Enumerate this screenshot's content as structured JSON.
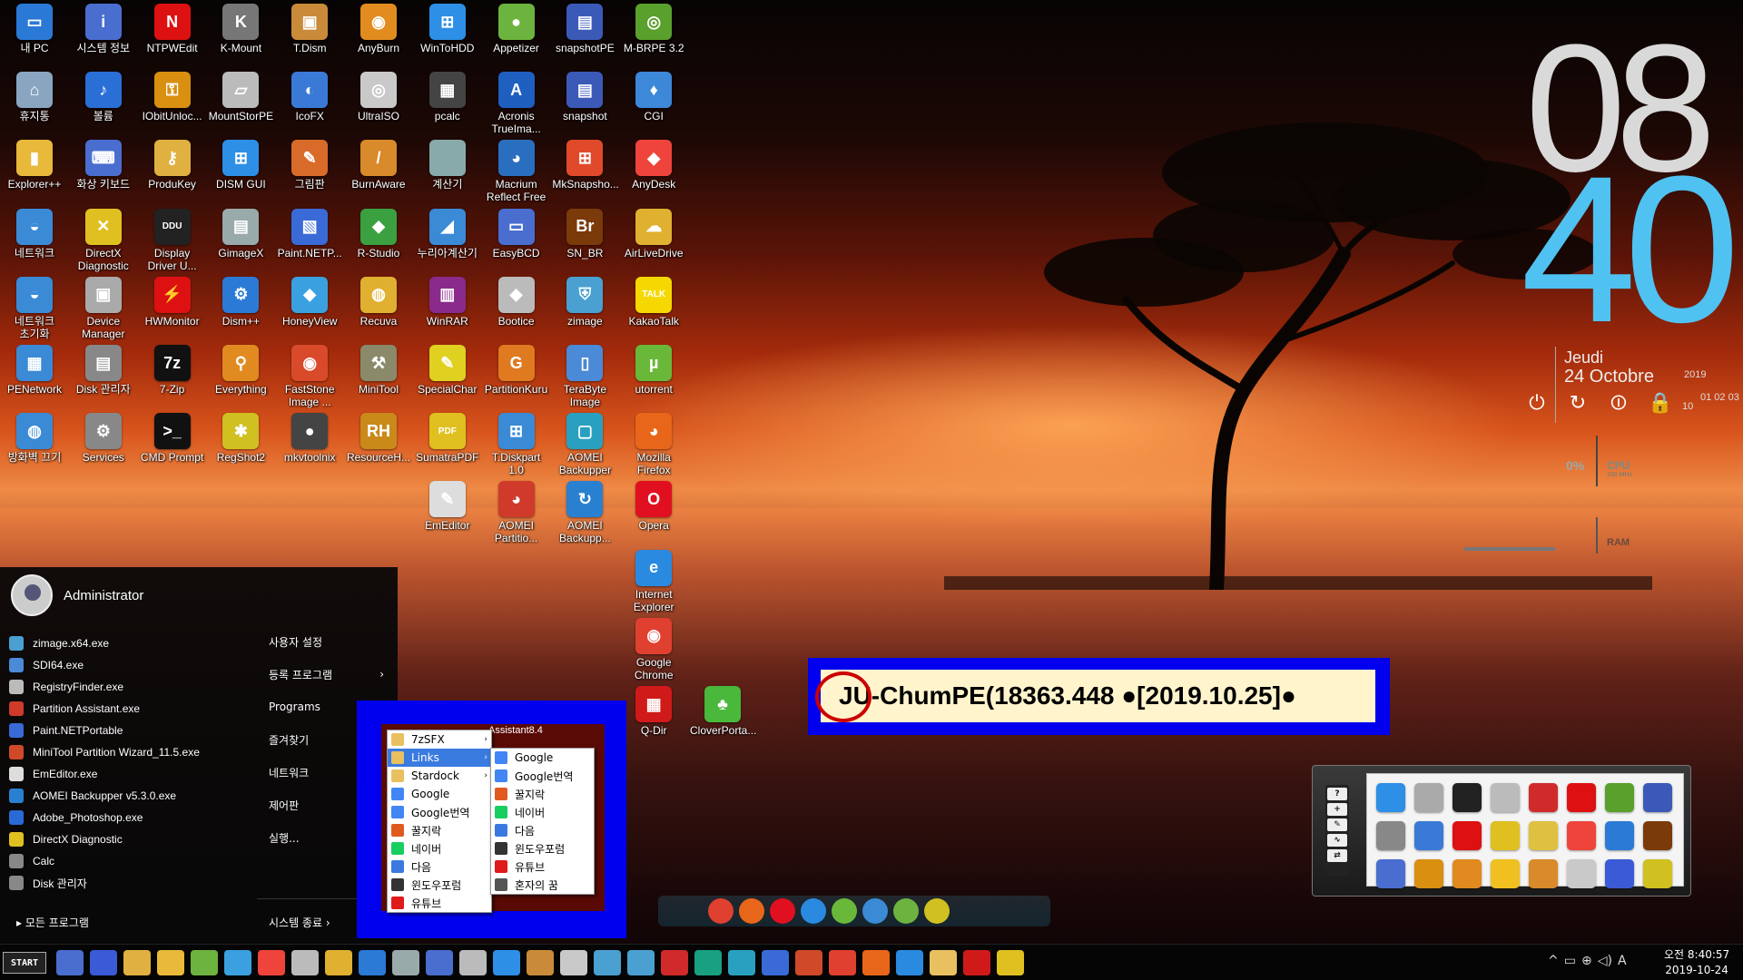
{
  "desktop_icons": [
    {
      "label": "내 PC",
      "color": "#2a79d6",
      "glyph": "▭"
    },
    {
      "label": "시스템 정보",
      "color": "#4a6ecf",
      "glyph": "i"
    },
    {
      "label": "NTPWEdit",
      "color": "#d11",
      "glyph": "N"
    },
    {
      "label": "K-Mount",
      "color": "#777",
      "glyph": "K"
    },
    {
      "label": "T.Dism",
      "color": "#c98b3a",
      "glyph": "▣"
    },
    {
      "label": "AnyBurn",
      "color": "#e28c20",
      "glyph": "◉"
    },
    {
      "label": "WinToHDD",
      "color": "#2d8fe6",
      "glyph": "⊞"
    },
    {
      "label": "Appetizer",
      "color": "#6db33f",
      "glyph": "●"
    },
    {
      "label": "snapshotPE",
      "color": "#3b5ab8",
      "glyph": "▤"
    },
    {
      "label": "M-BRPE 3.2",
      "color": "#5aa02c",
      "glyph": "◎"
    },
    {
      "label": "휴지통",
      "color": "#8aa5c0",
      "glyph": "⌂"
    },
    {
      "label": "볼륨",
      "color": "#2a6fd6",
      "glyph": "♪"
    },
    {
      "label": "IObitUnloc...",
      "color": "#d98f10",
      "glyph": "⚿"
    },
    {
      "label": "MountStorPE",
      "color": "#bbb",
      "glyph": "▱"
    },
    {
      "label": "IcoFX",
      "color": "#3a7ad6",
      "glyph": "◐"
    },
    {
      "label": "UltraISO",
      "color": "#c9c9c9",
      "glyph": "◎"
    },
    {
      "label": "pcalc",
      "color": "#444",
      "glyph": "▦"
    },
    {
      "label": "Acronis\nTrueIma...",
      "color": "#1f5fbf",
      "glyph": "A"
    },
    {
      "label": "snapshot",
      "color": "#3b5ab8",
      "glyph": "▤"
    },
    {
      "label": "CGI",
      "color": "#3d88d9",
      "glyph": "♦"
    },
    {
      "label": "Explorer++",
      "color": "#e8b93a",
      "glyph": "▮"
    },
    {
      "label": "화상 키보드",
      "color": "#4a6ecf",
      "glyph": "⌨"
    },
    {
      "label": "ProduKey",
      "color": "#e0b040",
      "glyph": "⚷"
    },
    {
      "label": "DISM GUI",
      "color": "#2d8fe6",
      "glyph": "⊞"
    },
    {
      "label": "그림판",
      "color": "#d96b2a",
      "glyph": "✎"
    },
    {
      "label": "BurnAware",
      "color": "#d98a2a",
      "glyph": "/"
    },
    {
      "label": "계산기",
      "color": "#8aa"
    },
    {
      "label": "Macrium\nReflect Free",
      "color": "#2a6fbf",
      "glyph": "◕"
    },
    {
      "label": "MkSnapsho...",
      "color": "#e04a2a",
      "glyph": "⊞"
    },
    {
      "label": "AnyDesk",
      "color": "#ef443b",
      "glyph": "◆"
    },
    {
      "label": "네트워크",
      "color": "#3a8ad6",
      "glyph": "◒"
    },
    {
      "label": "DirectX\nDiagnostic",
      "color": "#e0c020",
      "glyph": "✕"
    },
    {
      "label": "Display\nDriver U...",
      "color": "#222",
      "glyph": "DDU"
    },
    {
      "label": "GimageX",
      "color": "#9aa",
      "glyph": "▤"
    },
    {
      "label": "Paint.NETP...",
      "color": "#3a6ad6",
      "glyph": "▧"
    },
    {
      "label": "R-Studio",
      "color": "#3aa040",
      "glyph": "◆"
    },
    {
      "label": "누리아계산기",
      "color": "#3a8ad6",
      "glyph": "◢"
    },
    {
      "label": "EasyBCD",
      "color": "#4a6ecf",
      "glyph": "▭"
    },
    {
      "label": "SN_BR",
      "color": "#7a3a0a",
      "glyph": "Br"
    },
    {
      "label": "AirLiveDrive",
      "color": "#e0b030",
      "glyph": "☁"
    },
    {
      "label": "네트워크\n초기화",
      "color": "#3a8ad6",
      "glyph": "◒"
    },
    {
      "label": "Device\nManager",
      "color": "#aaa",
      "glyph": "▣"
    },
    {
      "label": "HWMonitor",
      "color": "#d11",
      "glyph": "⚡"
    },
    {
      "label": "Dism++",
      "color": "#2a7ad6",
      "glyph": "⚙"
    },
    {
      "label": "HoneyView",
      "color": "#3aa0e0",
      "glyph": "◆"
    },
    {
      "label": "Recuva",
      "color": "#e0b030",
      "glyph": "◍"
    },
    {
      "label": "WinRAR",
      "color": "#8a2a8a",
      "glyph": "▥"
    },
    {
      "label": "Bootice",
      "color": "#bbb",
      "glyph": "◆"
    },
    {
      "label": "zimage",
      "color": "#4aa0d0",
      "glyph": "⛨"
    },
    {
      "label": "KakaoTalk",
      "color": "#f5d800",
      "glyph": "TALK"
    },
    {
      "label": "PENetwork",
      "color": "#3a8ad6",
      "glyph": "▦"
    },
    {
      "label": "Disk 관리자",
      "color": "#888",
      "glyph": "▤"
    },
    {
      "label": "7-Zip",
      "color": "#111",
      "glyph": "7z"
    },
    {
      "label": "Everything",
      "color": "#e08a20",
      "glyph": "⚲"
    },
    {
      "label": "FastStone\nImage ...",
      "color": "#d94a2a",
      "glyph": "◉"
    },
    {
      "label": "MiniTool",
      "color": "#8a8a6a",
      "glyph": "⚒"
    },
    {
      "label": "SpecialChar",
      "color": "#e0d020",
      "glyph": "✎"
    },
    {
      "label": "PartitionKuru",
      "color": "#e07a20",
      "glyph": "G"
    },
    {
      "label": "TeraByte\nImage",
      "color": "#4a8ad6",
      "glyph": "▯"
    },
    {
      "label": "utorrent",
      "color": "#6ab83a",
      "glyph": "µ"
    },
    {
      "label": "방화벽 끄기",
      "color": "#3a8ad6",
      "glyph": "◍"
    },
    {
      "label": "Services",
      "color": "#888",
      "glyph": "⚙"
    },
    {
      "label": "CMD Prompt",
      "color": "#111",
      "glyph": ">_"
    },
    {
      "label": "RegShot2",
      "color": "#d0c020",
      "glyph": "✱"
    },
    {
      "label": "mkvtoolnix",
      "color": "#444",
      "glyph": "●"
    },
    {
      "label": "ResourceH...",
      "color": "#c98a1a",
      "glyph": "RH"
    },
    {
      "label": "SumatraPDF",
      "color": "#e0c020",
      "glyph": "PDF"
    },
    {
      "label": "T.Diskpart\n1.0",
      "color": "#3a8ad6",
      "glyph": "⊞"
    },
    {
      "label": "AOMEI\nBackupper",
      "color": "#2aa0c0",
      "glyph": "▢"
    },
    {
      "label": "Mozilla\nFirefox",
      "color": "#e8661a",
      "glyph": "◕"
    },
    {
      "label": "EmEditor",
      "color": "#ddd",
      "glyph": "✎"
    },
    {
      "label": "AOMEI\nPartitio...",
      "color": "#d03a2a",
      "glyph": "◕"
    },
    {
      "label": "AOMEI\nBackupp...",
      "color": "#2a80d0",
      "glyph": "↻"
    },
    {
      "label": "Opera",
      "color": "#e01020",
      "glyph": "O"
    },
    {
      "label": "Internet\nExplorer",
      "color": "#2a8ae0",
      "glyph": "e"
    },
    {
      "label": "Google\nChrome",
      "color": "#e04030",
      "glyph": "◉"
    },
    {
      "label": "Q-Dir",
      "color": "#d01a1a",
      "glyph": "▦"
    },
    {
      "label": "CloverPorta...",
      "color": "#4ab83a",
      "glyph": "♣"
    }
  ],
  "clock": {
    "hour": "08",
    "minute": "40",
    "dayname": "Jeudi",
    "date": "24 Octobre",
    "year": "2019",
    "days": "01 02 03",
    "month_num": "10"
  },
  "sysmon": {
    "cpu_value": "0%",
    "cpu_label": "CPU",
    "cpu_sub": "100 MHz",
    "ram_label": "RAM"
  },
  "power_icons": [
    "power-icon",
    "restart-icon",
    "sleep-icon",
    "lock-icon"
  ],
  "start_menu": {
    "username": "Administrator",
    "recent": [
      {
        "label": "zimage.x64.exe",
        "color": "#4aa0d0"
      },
      {
        "label": "SDI64.exe",
        "color": "#4a8ad6"
      },
      {
        "label": "RegistryFinder.exe",
        "color": "#bbb"
      },
      {
        "label": "Partition Assistant.exe",
        "color": "#d03a2a"
      },
      {
        "label": "Paint.NETPortable",
        "color": "#3a6ad6"
      },
      {
        "label": "MiniTool Partition Wizard_11.5.exe",
        "color": "#d04a2a"
      },
      {
        "label": "EmEditor.exe",
        "color": "#ddd"
      },
      {
        "label": "AOMEI Backupper v5.3.0.exe",
        "color": "#2a80d0"
      },
      {
        "label": "Adobe_Photoshop.exe",
        "color": "#2a6ad6"
      },
      {
        "label": "DirectX Diagnostic",
        "color": "#e0c020"
      },
      {
        "label": "Calc",
        "color": "#888"
      },
      {
        "label": "Disk 관리자",
        "color": "#888"
      }
    ],
    "right_items": [
      {
        "label": "사용자 설정",
        "arrow": ""
      },
      {
        "label": "등록 프로그램",
        "arrow": "›"
      },
      {
        "label": "Programs",
        "arrow": ""
      },
      {
        "label": "즐겨찾기",
        "arrow": ""
      },
      {
        "label": "네트워크",
        "arrow": ""
      },
      {
        "label": "제어판",
        "arrow": ""
      },
      {
        "label": "실행...",
        "arrow": ""
      }
    ],
    "all_programs": "▸ 모든 프로그램",
    "shutdown": "시스템 종료  ›"
  },
  "links_menu": {
    "assistant_text": "Assistant8.4",
    "level1": [
      {
        "label": "7zSFX",
        "color": "#e8c060",
        "arrow": "›"
      },
      {
        "label": "Links",
        "color": "#e8c060",
        "arrow": "›",
        "selected": true
      },
      {
        "label": "Stardock",
        "color": "#e8c060",
        "arrow": "›"
      },
      {
        "label": "Google",
        "color": "#4285f4",
        "arrow": ""
      },
      {
        "label": "Google번역",
        "color": "#4285f4",
        "arrow": ""
      },
      {
        "label": "꿀지락",
        "color": "#e05a20",
        "arrow": ""
      },
      {
        "label": "네이버",
        "color": "#19ce60",
        "arrow": ""
      },
      {
        "label": "다음",
        "color": "#3a7ae0",
        "arrow": ""
      },
      {
        "label": "윈도우포럼",
        "color": "#333",
        "arrow": ""
      },
      {
        "label": "유튜브",
        "color": "#e01a1a",
        "arrow": ""
      }
    ],
    "level2": [
      {
        "label": "Google",
        "color": "#4285f4"
      },
      {
        "label": "Google번역",
        "color": "#4285f4"
      },
      {
        "label": "꿀지락",
        "color": "#e05a20"
      },
      {
        "label": "네이버",
        "color": "#19ce60"
      },
      {
        "label": "다음",
        "color": "#3a7ae0"
      },
      {
        "label": "윈도우포럼",
        "color": "#333"
      },
      {
        "label": "유튜브",
        "color": "#e01a1a"
      },
      {
        "label": "혼자의 꿈",
        "color": "#555"
      }
    ]
  },
  "banner": {
    "text": "JU-ChumPE(18363.448 ●[2019.10.25]●"
  },
  "dock_side": [
    "?",
    "+",
    "✎",
    "∿",
    "⇄"
  ],
  "dock_colors": [
    "#2d8fe6",
    "#aaa",
    "#222",
    "#bbb",
    "#d02a2a",
    "#d11",
    "#5aa02c",
    "#3b5ab8",
    "#888",
    "#3a7ad6",
    "#d11",
    "#e0c020",
    "#e0c040",
    "#ef443b",
    "#2a7ad6",
    "#7a3a0a",
    "#4a6ecf",
    "#d98f10",
    "#e08a20",
    "#f0c020",
    "#d98a2a",
    "#c9c9c9",
    "#3a5ad6",
    "#d0c020"
  ],
  "mini_dock_colors": [
    "#e04030",
    "#e8661a",
    "#e01020",
    "#2a8ae0",
    "#6ab83a",
    "#3a8ad6",
    "#6db33f",
    "#d0c020"
  ],
  "taskbar": {
    "start_label": "START",
    "colors": [
      "#4a6ecf",
      "#3a5ad6",
      "#e0b040",
      "#e8b93a",
      "#6db33f",
      "#3aa0e0",
      "#ef443b",
      "#bbb",
      "#e0b030",
      "#2a7ad6",
      "#9aa",
      "#4a6ecf",
      "#bbb",
      "#2d8fe6",
      "#c98b3a",
      "#c9c9c9",
      "#4aa0d0",
      "#4aa0d0",
      "#d02a2a",
      "#19a080",
      "#2aa0c0",
      "#3a6ad6",
      "#d04a2a",
      "#e04030",
      "#e8661a",
      "#2a8ae0",
      "#e8c060",
      "#d01a1a",
      "#e0c020"
    ],
    "tray": [
      "^",
      "▭",
      "⊕",
      "◁)",
      "A"
    ],
    "time": "오전 8:40:57",
    "date": "2019-10-24"
  }
}
